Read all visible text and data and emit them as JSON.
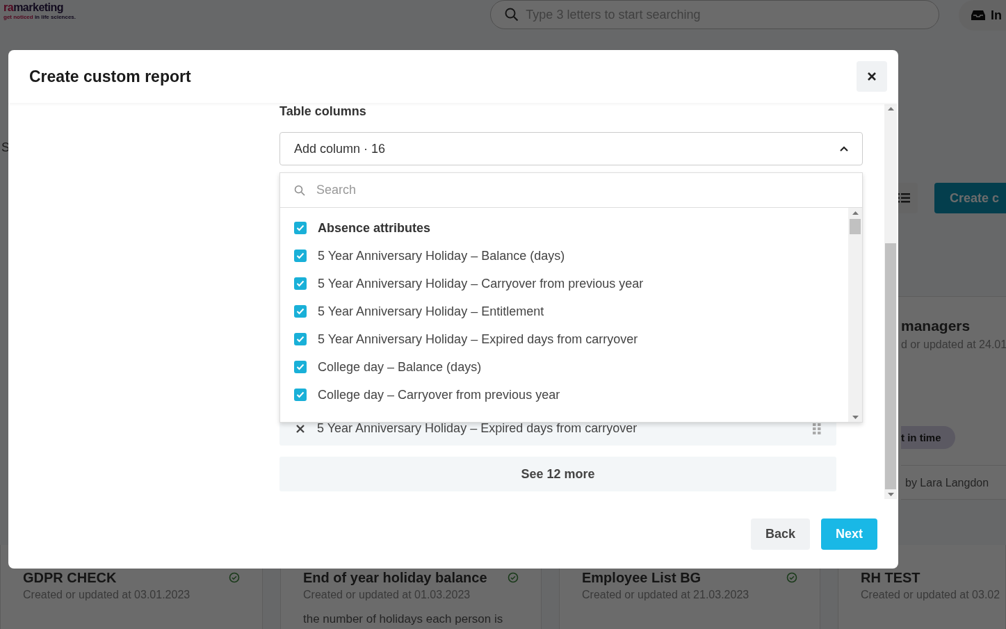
{
  "background": {
    "logo": {
      "name_accent": "ra",
      "name": "marketing",
      "tagline_accent": "get noticed",
      "tagline": " in life sciences."
    },
    "search": {
      "placeholder": "Type 3 letters to start searching"
    },
    "inbox_button": "In",
    "section_letter": "S",
    "create_button": "Create c",
    "side_card": {
      "title": "managers",
      "subtitle": "d or updated at 24.01",
      "tag": "t in time",
      "author": "by Lara Langdon"
    },
    "cards": [
      {
        "title": "GDPR CHECK",
        "date": "Created or updated at 03.01.2023",
        "verified": true
      },
      {
        "title": "End of year holiday balance",
        "date": "Created or updated at 01.03.2023",
        "verified": true,
        "description": "the number of holidays each person is"
      },
      {
        "title": "Employee List BG",
        "date": "Created or updated at 21.03.2023",
        "verified": true
      },
      {
        "title": "RH TEST",
        "date": "Created or updated at 03.02",
        "verified": false
      }
    ]
  },
  "modal": {
    "title": "Create custom report",
    "section_label": "Table columns",
    "column_select": {
      "value": "Add column · 16",
      "expanded": true
    },
    "dropdown": {
      "search_placeholder": "Search",
      "options": [
        {
          "kind": "group",
          "label": "Absence attributes",
          "checked": true
        },
        {
          "kind": "option",
          "label": "5 Year Anniversary Holiday – Balance (days)",
          "checked": true
        },
        {
          "kind": "option",
          "label": "5 Year Anniversary Holiday – Carryover from previous year",
          "checked": true
        },
        {
          "kind": "option",
          "label": "5 Year Anniversary Holiday – Entitlement",
          "checked": true
        },
        {
          "kind": "option",
          "label": "5 Year Anniversary Holiday – Expired days from carryover",
          "checked": true
        },
        {
          "kind": "option",
          "label": "College day – Balance (days)",
          "checked": true
        },
        {
          "kind": "option",
          "label": "College day – Carryover from previous year",
          "checked": true
        }
      ]
    },
    "selected_columns": [
      {
        "label": "5 Year Anniversary Holiday – Expired days from carryover"
      }
    ],
    "see_more": "See 12 more",
    "back_button": "Back",
    "next_button": "Next"
  }
}
